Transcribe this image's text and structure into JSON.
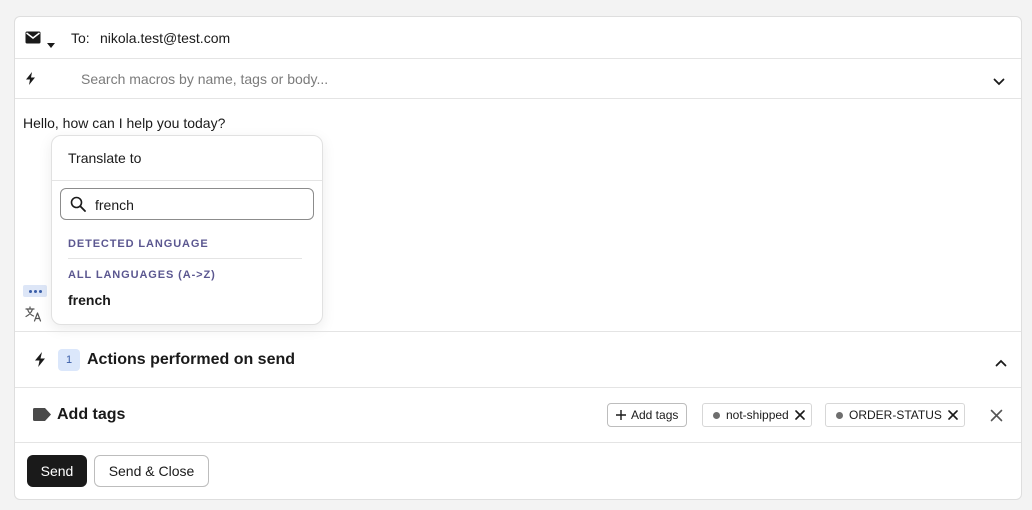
{
  "recipient": {
    "to_label": "To:",
    "to_value": "nikola.test@test.com",
    "channel_icon": "envelope-icon"
  },
  "macros": {
    "search_placeholder": "Search macros by name, tags or body..."
  },
  "editor": {
    "body_text": "Hello, how can I help you today?"
  },
  "translate_popover": {
    "title": "Translate to",
    "search_value": "french",
    "detected_label": "DETECTED LANGUAGE",
    "all_label": "ALL LANGUAGES (A->Z)",
    "results": [
      "french"
    ]
  },
  "actions": {
    "count": "1",
    "title": "Actions performed on send"
  },
  "tags": {
    "title": "Add tags",
    "add_button": "Add tags",
    "chips": [
      "not-shipped",
      "ORDER-STATUS"
    ]
  },
  "footer": {
    "send_label": "Send",
    "send_close_label": "Send & Close"
  },
  "colors": {
    "accent": "#3a5ea8",
    "badge_bg": "#dbe7fb",
    "section_label": "#5b5790",
    "primary_button": "#1a1a1a"
  }
}
